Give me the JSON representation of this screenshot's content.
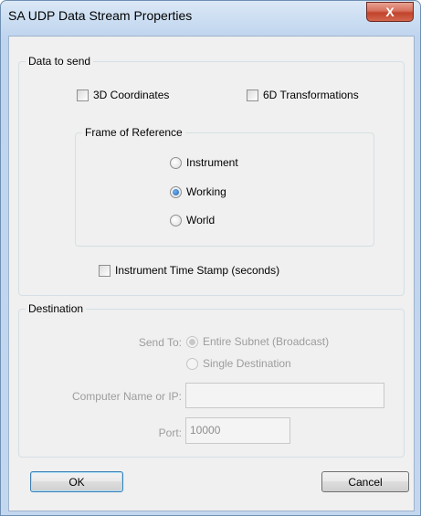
{
  "window": {
    "title": "SA UDP Data Stream Properties",
    "close_glyph": "X"
  },
  "data_to_send": {
    "legend": "Data to send",
    "coords_label": "3D Coordinates",
    "coords_checked": false,
    "transforms_label": "6D Transformations",
    "transforms_checked": false,
    "frame": {
      "legend": "Frame of Reference",
      "options": [
        "Instrument",
        "Working",
        "World"
      ],
      "selected": "Working"
    },
    "timestamp_label": "Instrument Time Stamp (seconds)",
    "timestamp_checked": false
  },
  "destination": {
    "legend": "Destination",
    "send_to_label": "Send To:",
    "options": [
      "Entire Subnet (Broadcast)",
      "Single Destination"
    ],
    "selected": "Entire Subnet (Broadcast)",
    "computer_label": "Computer Name or IP:",
    "computer_value": "",
    "port_label": "Port:",
    "port_value": "10000"
  },
  "buttons": {
    "ok": "OK",
    "cancel": "Cancel"
  }
}
